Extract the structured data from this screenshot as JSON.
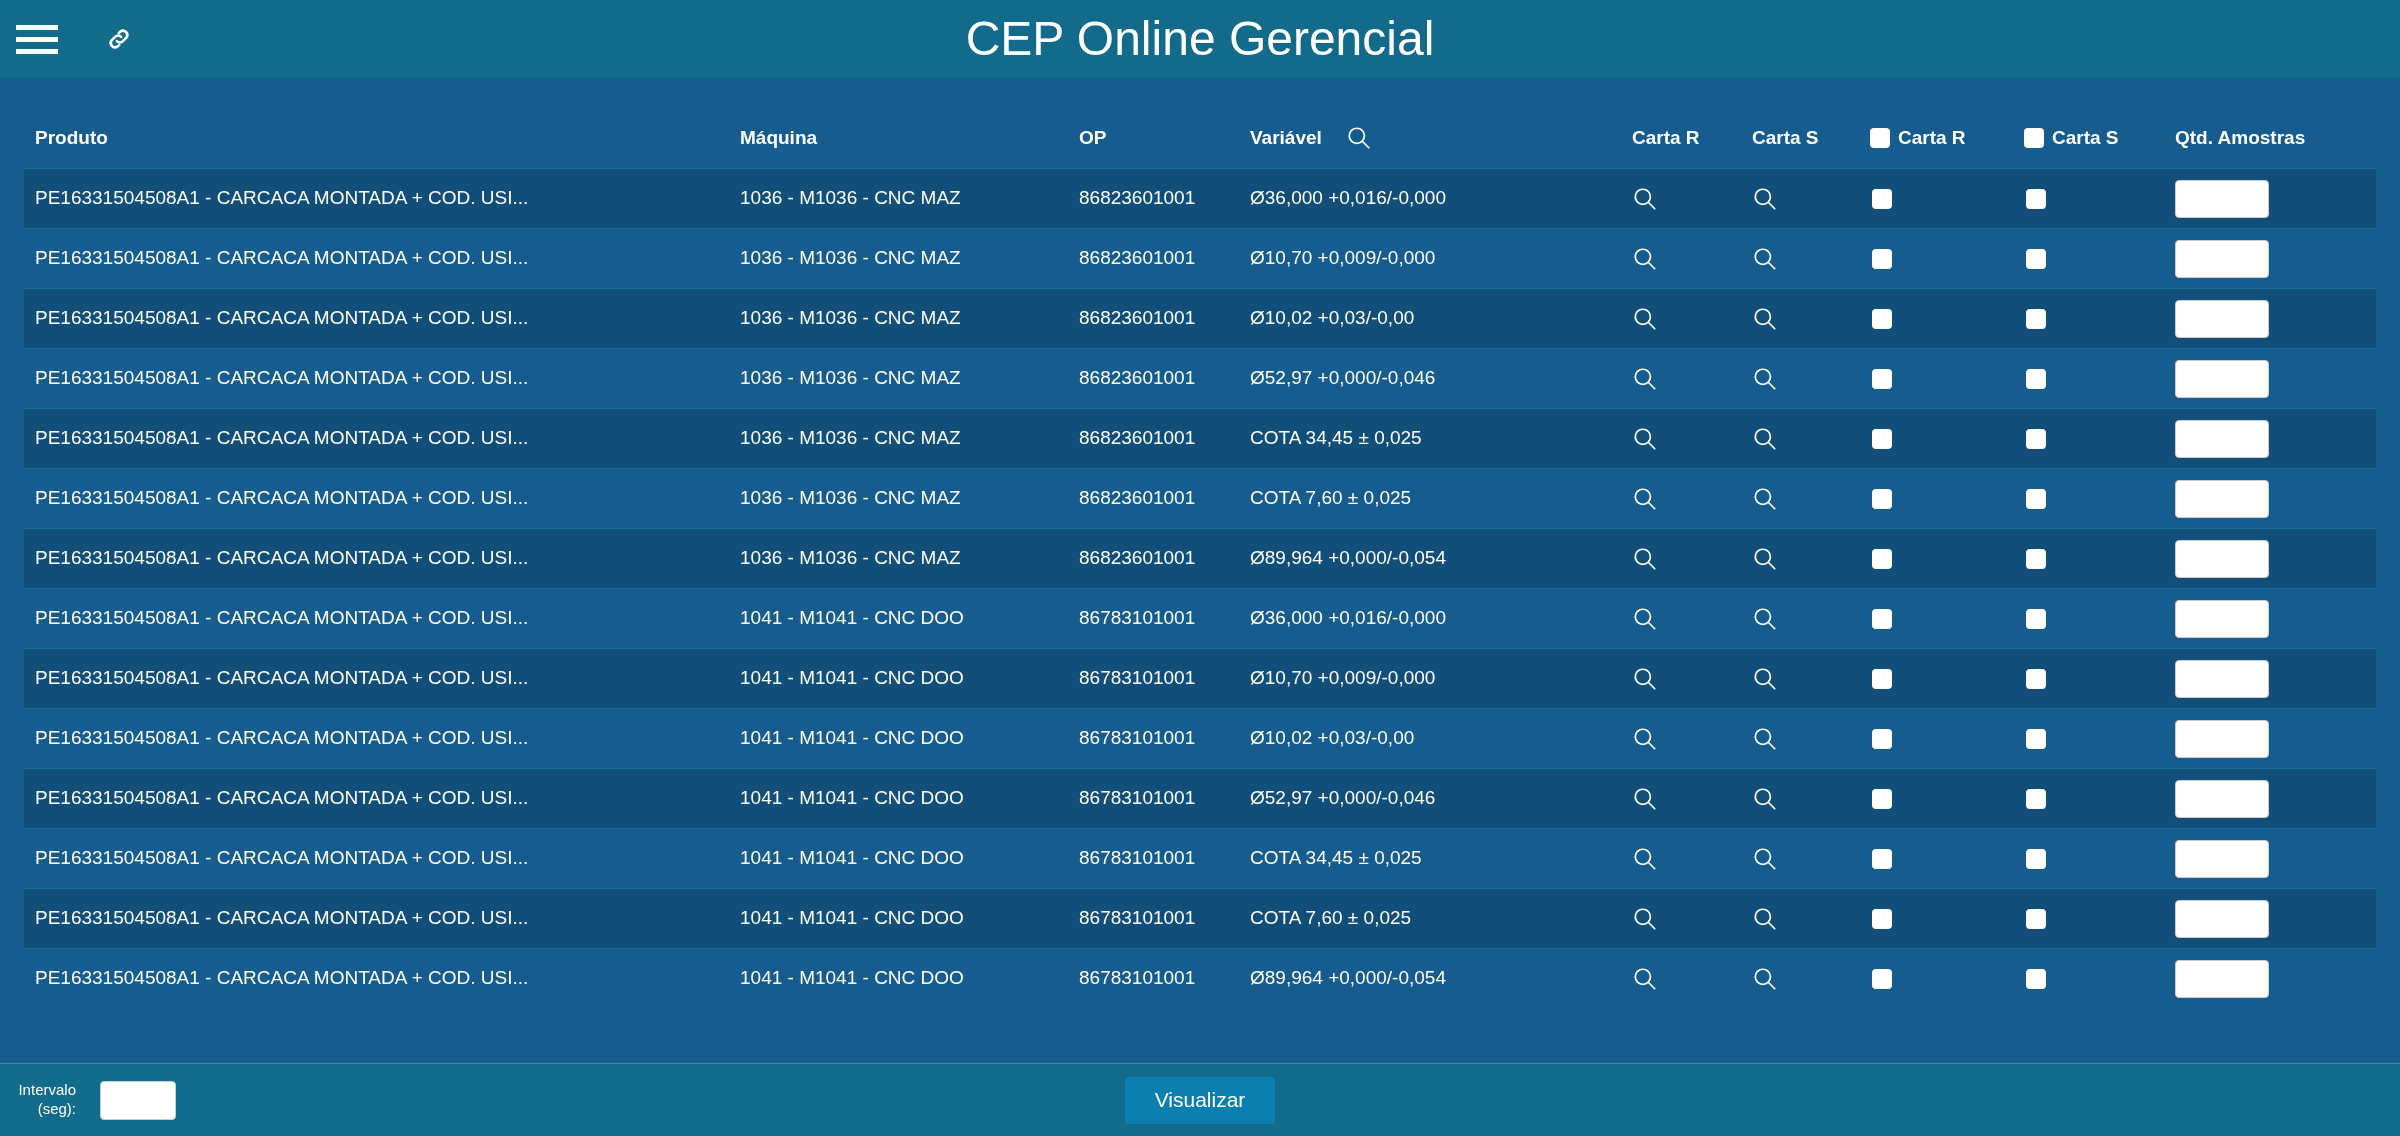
{
  "header": {
    "title": "CEP Online Gerencial"
  },
  "table": {
    "columns": [
      {
        "kind": "text",
        "label": "Produto"
      },
      {
        "kind": "text",
        "label": "Máquina"
      },
      {
        "kind": "text",
        "label": "OP"
      },
      {
        "kind": "search",
        "label": "Variável"
      },
      {
        "kind": "text",
        "label": "Carta R"
      },
      {
        "kind": "text",
        "label": "Carta S"
      },
      {
        "kind": "check",
        "label": "Carta R",
        "checked": false
      },
      {
        "kind": "check",
        "label": "Carta S",
        "checked": false
      },
      {
        "kind": "text",
        "label": "Qtd. Amostras"
      }
    ],
    "rows": [
      {
        "produto": "PE16331504508A1 - CARCACA MONTADA + COD. USI...",
        "maquina": "1036 - M1036 - CNC MAZ",
        "op": "86823601001",
        "variavel": "Ø36,000 +0,016/-0,000",
        "carta_r": false,
        "carta_s": false
      },
      {
        "produto": "PE16331504508A1 - CARCACA MONTADA + COD. USI...",
        "maquina": "1036 - M1036 - CNC MAZ",
        "op": "86823601001",
        "variavel": "Ø10,70 +0,009/-0,000",
        "carta_r": false,
        "carta_s": false
      },
      {
        "produto": "PE16331504508A1 - CARCACA MONTADA + COD. USI...",
        "maquina": "1036 - M1036 - CNC MAZ",
        "op": "86823601001",
        "variavel": "Ø10,02 +0,03/-0,00",
        "carta_r": false,
        "carta_s": false
      },
      {
        "produto": "PE16331504508A1 - CARCACA MONTADA + COD. USI...",
        "maquina": "1036 - M1036 - CNC MAZ",
        "op": "86823601001",
        "variavel": "Ø52,97 +0,000/-0,046",
        "carta_r": false,
        "carta_s": false
      },
      {
        "produto": "PE16331504508A1 - CARCACA MONTADA + COD. USI...",
        "maquina": "1036 - M1036 - CNC MAZ",
        "op": "86823601001",
        "variavel": "COTA 34,45 ± 0,025",
        "carta_r": false,
        "carta_s": false
      },
      {
        "produto": "PE16331504508A1 - CARCACA MONTADA + COD. USI...",
        "maquina": "1036 - M1036 - CNC MAZ",
        "op": "86823601001",
        "variavel": "COTA 7,60 ± 0,025",
        "carta_r": false,
        "carta_s": false
      },
      {
        "produto": "PE16331504508A1 - CARCACA MONTADA + COD. USI...",
        "maquina": "1036 - M1036 - CNC MAZ",
        "op": "86823601001",
        "variavel": "Ø89,964 +0,000/-0,054",
        "carta_r": false,
        "carta_s": false
      },
      {
        "produto": "PE16331504508A1 - CARCACA MONTADA + COD. USI...",
        "maquina": "1041 - M1041 - CNC DOO",
        "op": "86783101001",
        "variavel": "Ø36,000 +0,016/-0,000",
        "carta_r": false,
        "carta_s": false
      },
      {
        "produto": "PE16331504508A1 - CARCACA MONTADA + COD. USI...",
        "maquina": "1041 - M1041 - CNC DOO",
        "op": "86783101001",
        "variavel": "Ø10,70 +0,009/-0,000",
        "carta_r": false,
        "carta_s": false
      },
      {
        "produto": "PE16331504508A1 - CARCACA MONTADA + COD. USI...",
        "maquina": "1041 - M1041 - CNC DOO",
        "op": "86783101001",
        "variavel": "Ø10,02 +0,03/-0,00",
        "carta_r": false,
        "carta_s": false
      },
      {
        "produto": "PE16331504508A1 - CARCACA MONTADA + COD. USI...",
        "maquina": "1041 - M1041 - CNC DOO",
        "op": "86783101001",
        "variavel": "Ø52,97 +0,000/-0,046",
        "carta_r": false,
        "carta_s": false
      },
      {
        "produto": "PE16331504508A1 - CARCACA MONTADA + COD. USI...",
        "maquina": "1041 - M1041 - CNC DOO",
        "op": "86783101001",
        "variavel": "COTA 34,45 ± 0,025",
        "carta_r": false,
        "carta_s": false
      },
      {
        "produto": "PE16331504508A1 - CARCACA MONTADA + COD. USI...",
        "maquina": "1041 - M1041 - CNC DOO",
        "op": "86783101001",
        "variavel": "COTA 7,60 ± 0,025",
        "carta_r": false,
        "carta_s": false
      },
      {
        "produto": "PE16331504508A1 - CARCACA MONTADA + COD. USI...",
        "maquina": "1041 - M1041 - CNC DOO",
        "op": "86783101001",
        "variavel": "Ø89,964 +0,000/-0,054",
        "carta_r": false,
        "carta_s": false
      }
    ]
  },
  "footer": {
    "interval_label": "Intervalo (seg):",
    "button": "Visualizar"
  }
}
